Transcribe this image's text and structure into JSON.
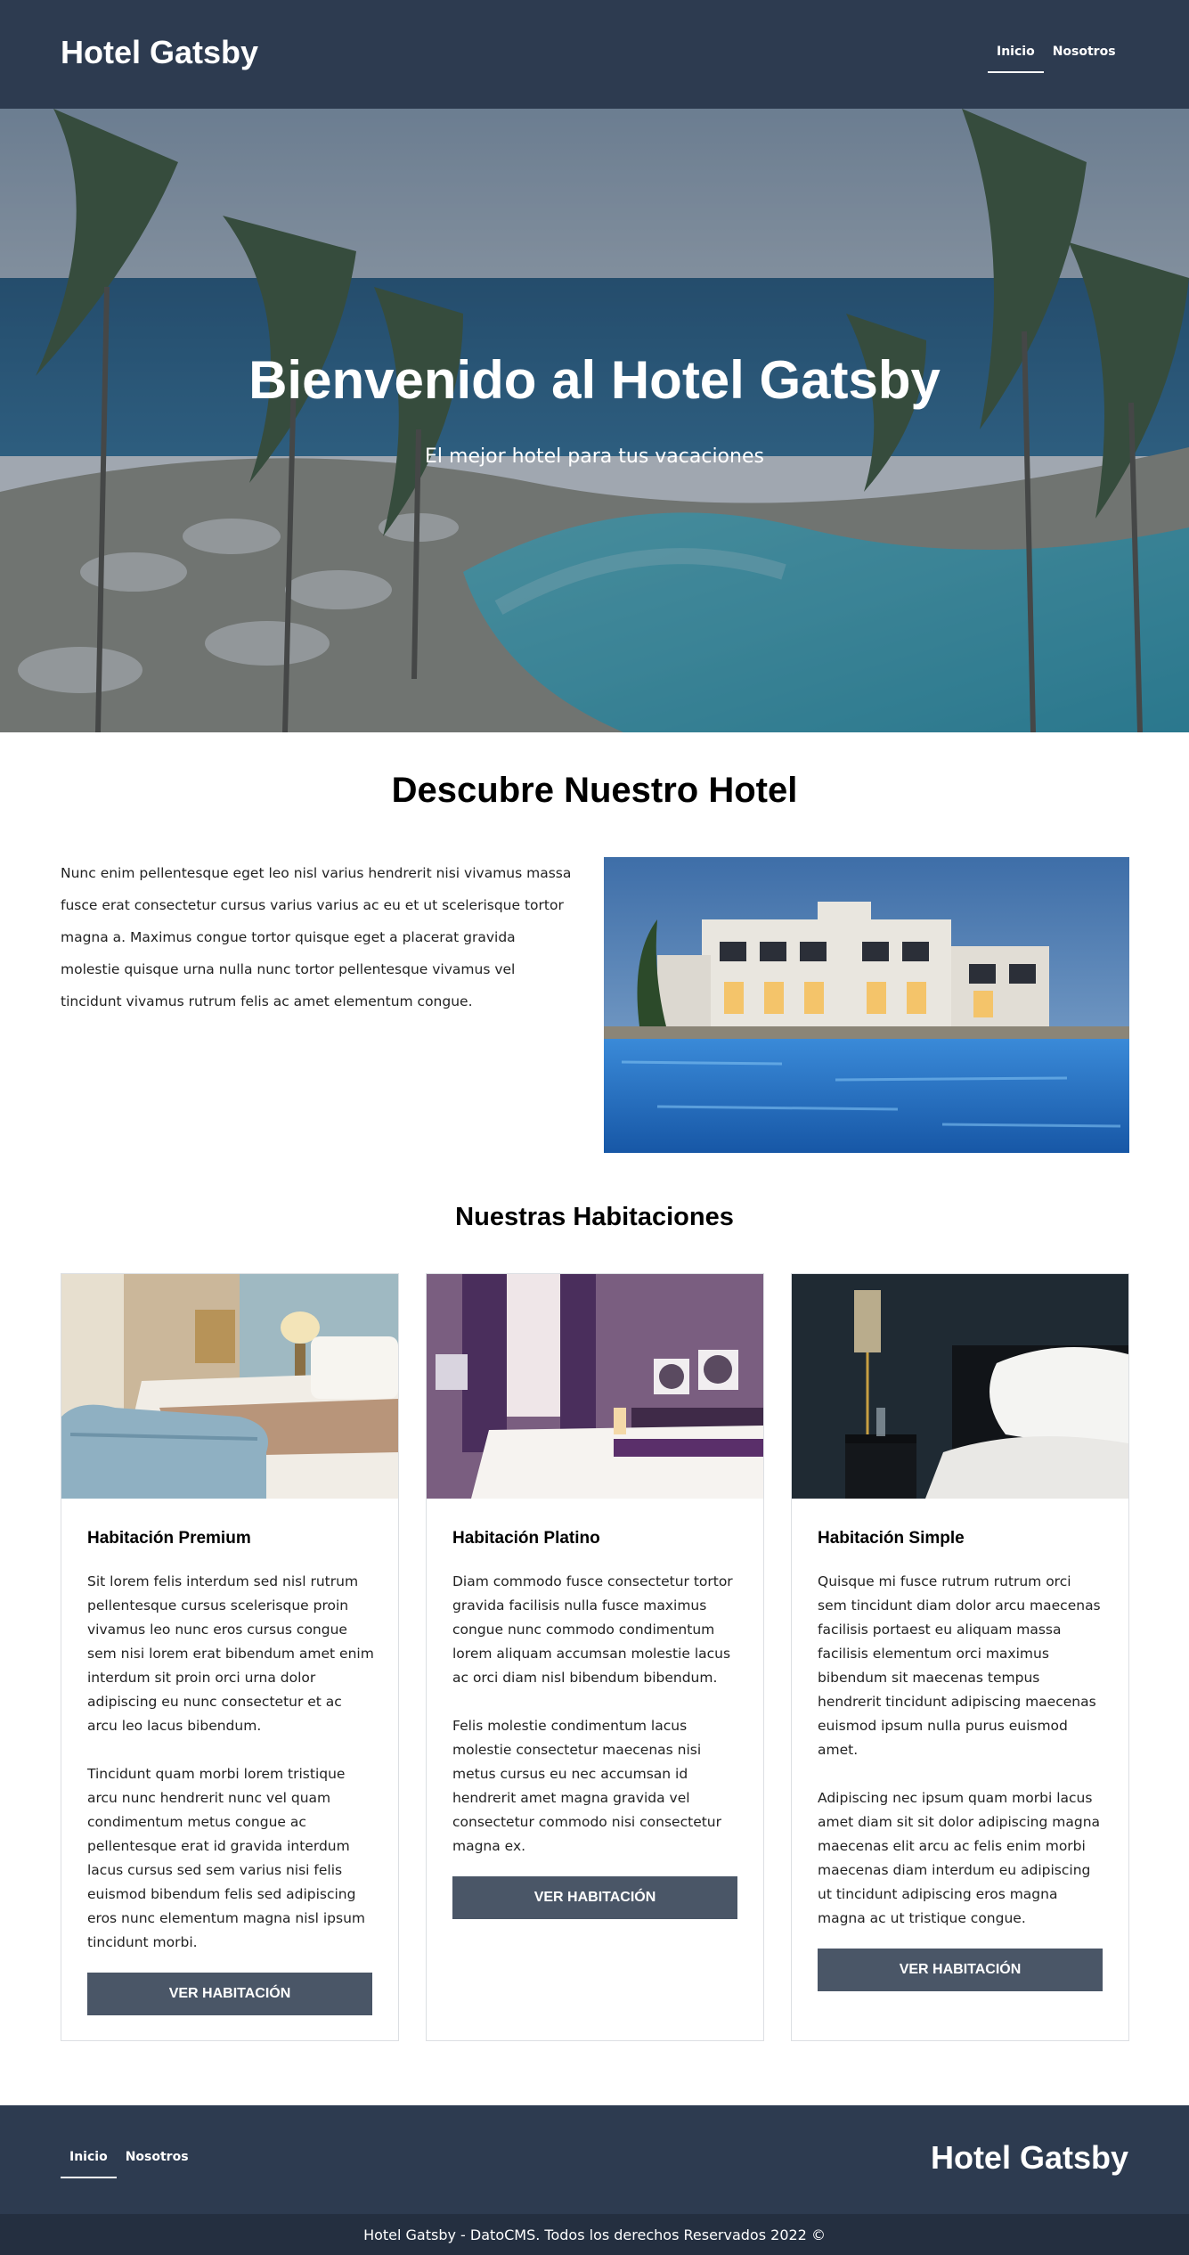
{
  "header": {
    "brand": "Hotel Gatsby",
    "nav": [
      {
        "label": "Inicio",
        "active": true
      },
      {
        "label": "Nosotros",
        "active": false
      }
    ]
  },
  "hero": {
    "title": "Bienvenido al Hotel Gatsby",
    "subtitle": "El mejor hotel para tus vacaciones"
  },
  "about": {
    "title": "Descubre Nuestro Hotel",
    "text": "Nunc enim pellentesque eget leo nisl varius hendrerit nisi vivamus massa fusce erat consectetur cursus varius varius ac eu et ut scelerisque tortor magna a. Maximus congue tortor quisque eget a placerat gravida molestie quisque urna nulla nunc tortor pellentesque vivamus vel tincidunt vivamus rutrum felis ac amet elementum congue."
  },
  "rooms": {
    "title": "Nuestras Habitaciones",
    "items": [
      {
        "title": "Habitación Premium",
        "paragraphs": [
          "Sit lorem felis interdum sed nisl rutrum pellentesque cursus scelerisque proin vivamus leo nunc eros cursus congue sem nisi lorem erat bibendum amet enim interdum sit proin orci urna dolor adipiscing eu nunc consectetur et ac arcu leo lacus bibendum.",
          "Tincidunt quam morbi lorem tristique arcu nunc hendrerit nunc vel quam condimentum metus congue ac pellentesque erat id gravida interdum lacus cursus sed sem varius nisi felis euismod bibendum felis sed adipiscing eros nunc elementum magna nisl ipsum tincidunt morbi."
        ],
        "button": "VER HABITACIÓN"
      },
      {
        "title": "Habitación Platino",
        "paragraphs": [
          "Diam commodo fusce consectetur tortor gravida facilisis nulla fusce maximus congue nunc commodo condimentum lorem aliquam accumsan molestie lacus ac orci diam nisl bibendum bibendum.",
          "Felis molestie condimentum lacus molestie consectetur maecenas nisi metus cursus eu nec accumsan id hendrerit amet magna gravida vel consectetur commodo nisi consectetur magna ex."
        ],
        "button": "VER HABITACIÓN"
      },
      {
        "title": "Habitación Simple",
        "paragraphs": [
          "Quisque mi fusce rutrum rutrum orci sem tincidunt diam dolor arcu maecenas facilisis portaest eu aliquam massa facilisis elementum orci maximus bibendum sit maecenas tempus hendrerit tincidunt adipiscing maecenas euismod ipsum nulla purus euismod amet.",
          "Adipiscing nec ipsum quam morbi lacus amet diam sit sit dolor adipiscing magna maecenas elit arcu ac felis enim morbi maecenas diam interdum eu adipiscing ut tincidunt adipiscing eros magna magna ac ut tristique congue."
        ],
        "button": "VER HABITACIÓN"
      }
    ]
  },
  "footer": {
    "nav": [
      {
        "label": "Inicio",
        "active": true
      },
      {
        "label": "Nosotros",
        "active": false
      }
    ],
    "brand": "Hotel Gatsby",
    "copyright": "Hotel Gatsby - DatoCMS. Todos los derechos Reservados 2022 ©"
  }
}
